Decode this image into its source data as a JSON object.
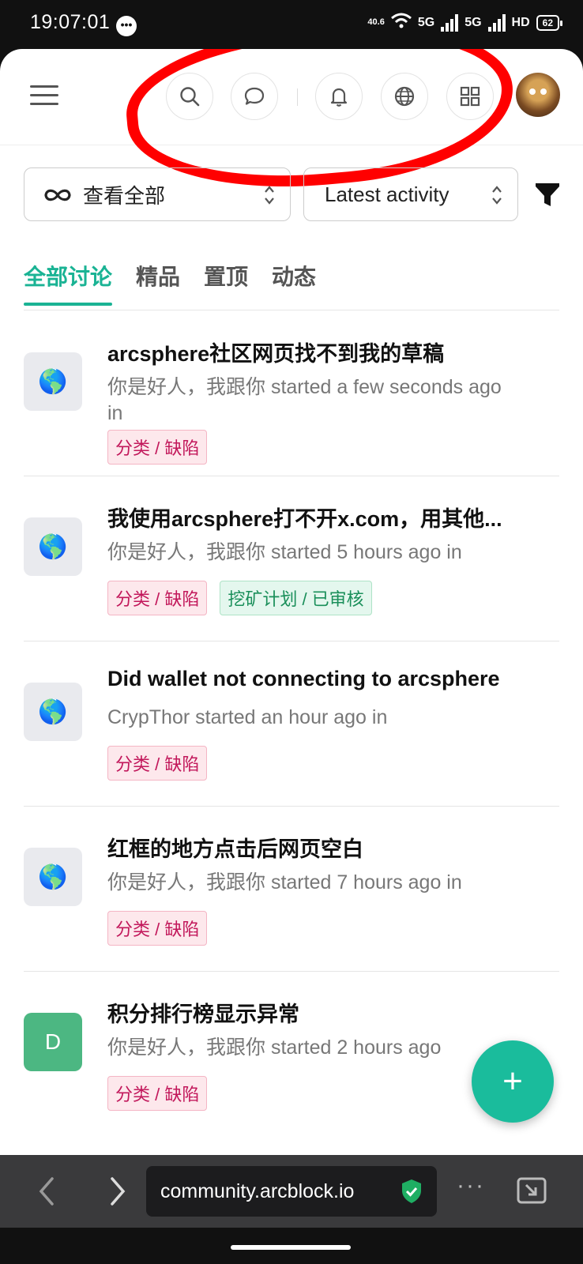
{
  "status_bar": {
    "time": "19:07:01",
    "speed_value": "40.6",
    "net1": "5G",
    "net2": "5G",
    "hd": "HD",
    "battery": "62"
  },
  "header": {
    "icons": [
      "menu-icon",
      "search-icon",
      "chat-icon",
      "bell-icon",
      "globe-icon",
      "apps-icon",
      "avatar"
    ]
  },
  "filters": {
    "view_label": "查看全部",
    "sort_label": "Latest activity"
  },
  "tabs": [
    {
      "label": "全部讨论",
      "active": true
    },
    {
      "label": "精品",
      "active": false
    },
    {
      "label": "置顶",
      "active": false
    },
    {
      "label": "动态",
      "active": false
    }
  ],
  "discussions": [
    {
      "thumb": "🌎",
      "title": "arcsphere社区网页找不到我的草稿",
      "meta": "你是好人，我跟你 started a few seconds ago in",
      "tags": [
        {
          "label": "分类 / 缺陷",
          "color": "#c2185b"
        }
      ]
    },
    {
      "thumb": "🌎",
      "title": "我使用arcsphere打不开x.com，用其他...",
      "meta": "你是好人，我跟你 started 5 hours ago in",
      "tags": [
        {
          "label": "分类 / 缺陷",
          "color": "#c2185b"
        },
        {
          "label": "挖矿计划 / 已审核",
          "color": "#1a8f5a"
        }
      ]
    },
    {
      "thumb": "🌎",
      "title": "Did wallet not connecting to arcsphere",
      "meta": "CrypThor started an hour ago in",
      "tags": [
        {
          "label": "分类 / 缺陷",
          "color": "#c2185b"
        }
      ]
    },
    {
      "thumb": "🌎",
      "title": "红框的地方点击后网页空白",
      "meta": "你是好人，我跟你 started 7 hours ago in",
      "tags": [
        {
          "label": "分类 / 缺陷",
          "color": "#c2185b"
        }
      ]
    },
    {
      "thumb": "D",
      "title": "积分排行榜显示异常",
      "meta": "你是好人，我跟你 started 2 hours ago",
      "tags": [
        {
          "label": "分类 / 缺陷",
          "color": "#c2185b"
        }
      ]
    }
  ],
  "fab": {
    "label": "+"
  },
  "browser": {
    "url": "community.arcblock.io",
    "more": "···"
  },
  "colors": {
    "accent": "#1ab394",
    "annotation": "#ff0000"
  }
}
